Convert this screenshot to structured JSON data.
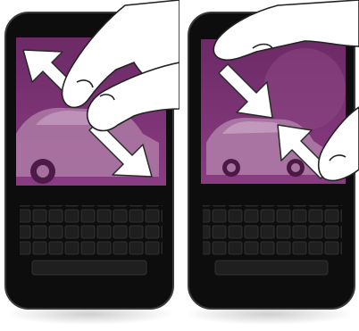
{
  "figure": {
    "panels": [
      {
        "gesture": "zoom-in",
        "finger_motion": "spread-apart"
      },
      {
        "gesture": "zoom-out",
        "finger_motion": "pinch-together"
      }
    ],
    "colors": {
      "device_body": "#0d0d0d",
      "device_edge": "#3a3a3a",
      "screen_purple": "#7a2d72",
      "screen_purple_dark": "#5e1f58",
      "car": "#a974a1",
      "arrow": "#ffffff",
      "key": "#1d1d1d",
      "hand_fill": "#ffffff",
      "hand_outline": "#222222"
    },
    "keyboard": {
      "rows": 3,
      "keys_per_row": 10
    }
  }
}
